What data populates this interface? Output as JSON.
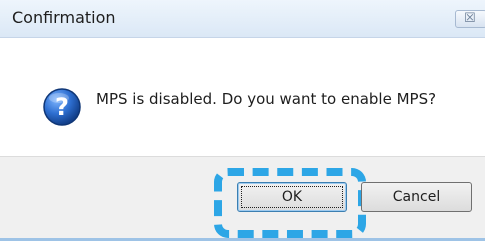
{
  "window": {
    "title": "Confirmation",
    "close_glyph": "☒",
    "close_icon": "close-icon"
  },
  "message": {
    "icon": "question-icon",
    "text": "MPS is disabled. Do you want to enable MPS?"
  },
  "buttons": {
    "ok_label": "OK",
    "cancel_label": "Cancel"
  },
  "colors": {
    "highlight": "#2da6e6",
    "icon_blue": "#1f5fb3",
    "titlebar": "#dbe8f6"
  }
}
